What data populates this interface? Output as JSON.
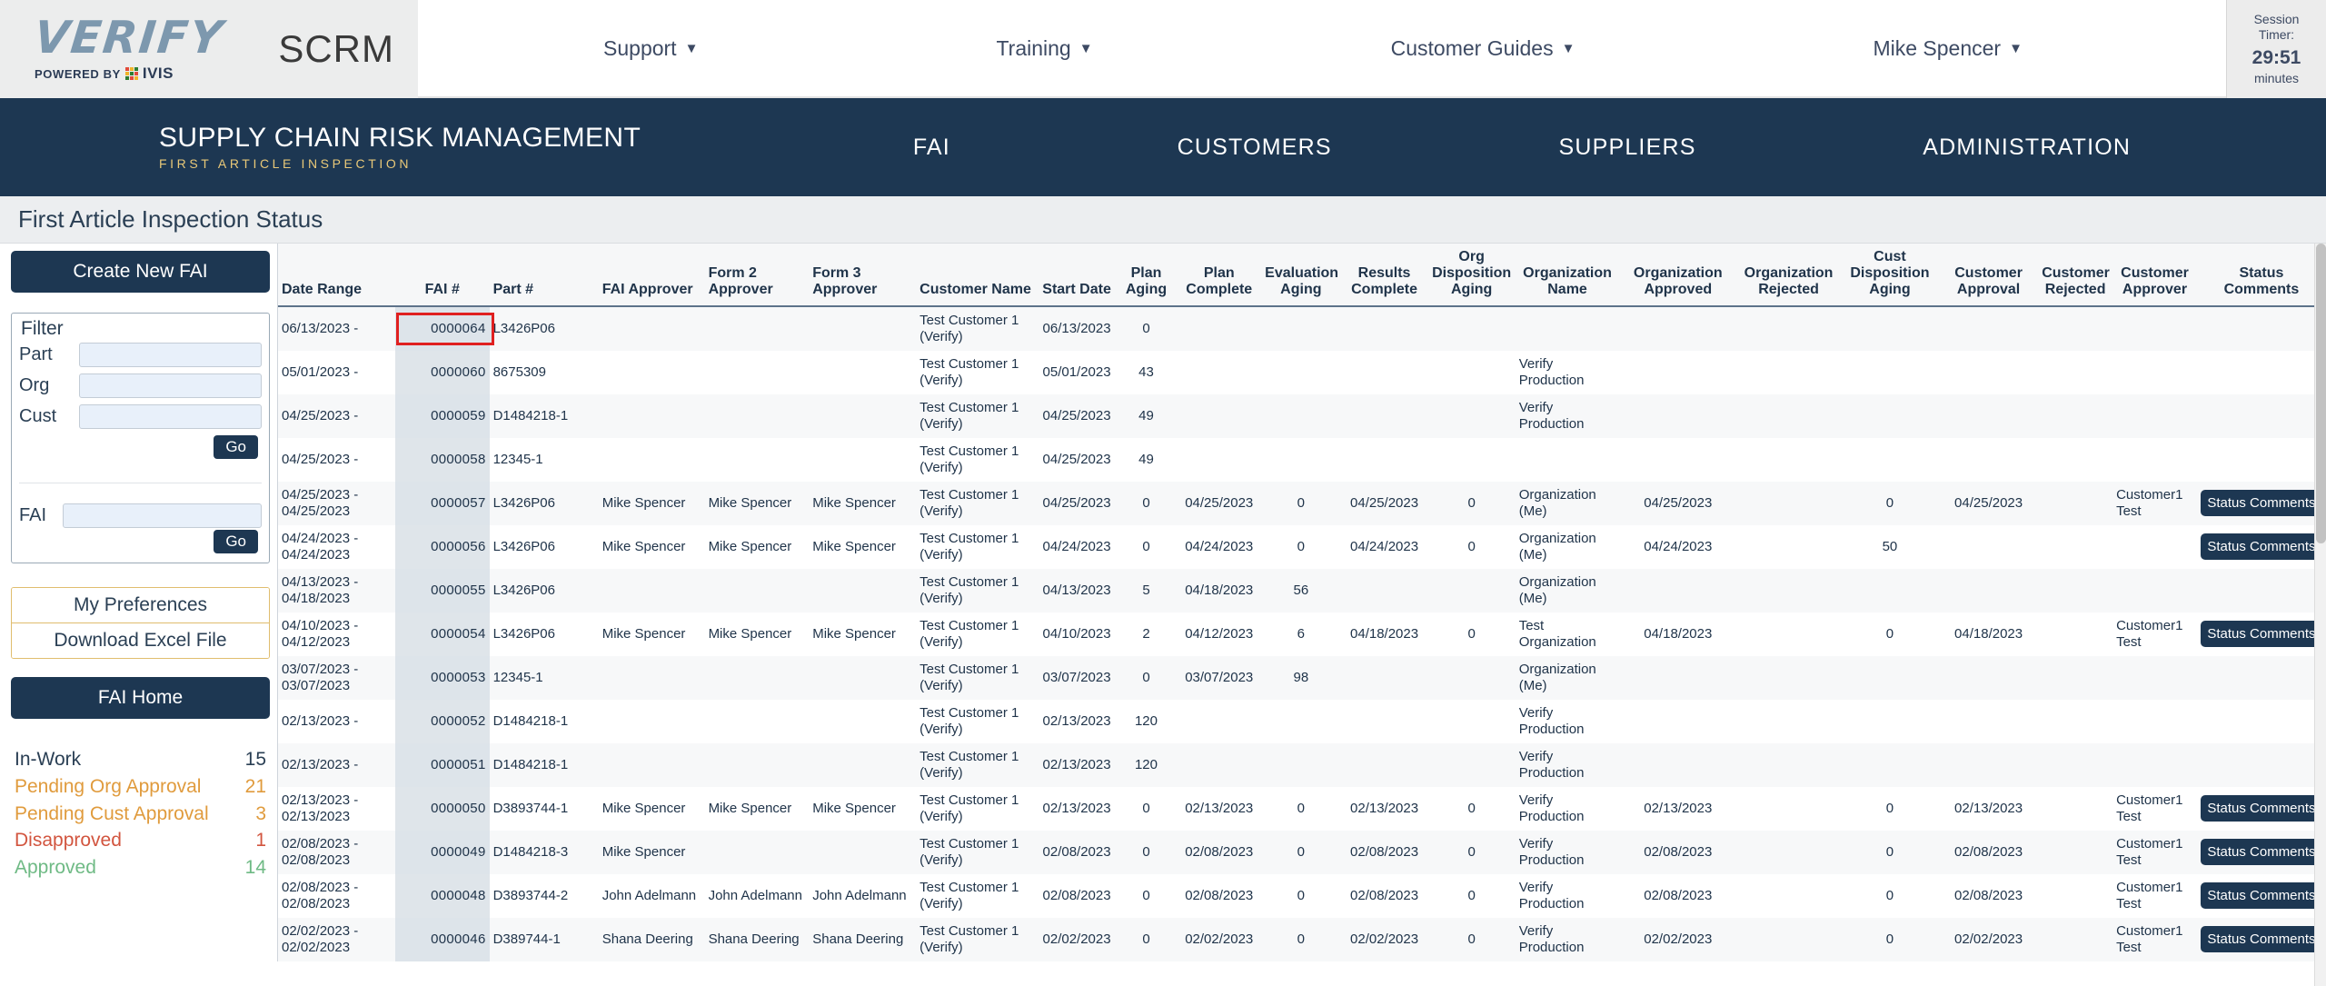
{
  "brand": {
    "logo_word": "VERIFY",
    "logo_powered_by": "POWERED BY",
    "logo_ivis": "IVIS",
    "app_abbrev": "SCRM"
  },
  "topnav": {
    "items": [
      {
        "label": "Support",
        "caret": "chevron-down-icon"
      },
      {
        "label": "Training",
        "caret": "chevron-down-icon"
      },
      {
        "label": "Customer Guides",
        "caret": "chevron-down-icon"
      },
      {
        "label": "Mike Spencer",
        "caret": "chevron-down-icon"
      }
    ],
    "session": {
      "line1": "Session",
      "line2": "Timer:",
      "time": "29:51",
      "unit": "minutes"
    }
  },
  "banner": {
    "title": "SUPPLY CHAIN RISK MANAGEMENT",
    "subtitle": "FIRST ARTICLE INSPECTION",
    "links": [
      "FAI",
      "CUSTOMERS",
      "SUPPLIERS",
      "ADMINISTRATION"
    ]
  },
  "page": {
    "title": "First Article Inspection Status"
  },
  "sidebar": {
    "create_button": "Create New FAI",
    "filter": {
      "title": "Filter",
      "part_label": "Part",
      "part_value": "",
      "org_label": "Org",
      "org_value": "",
      "cust_label": "Cust",
      "cust_value": "",
      "go_label": "Go",
      "fai_label": "FAI",
      "fai_value": "",
      "fai_go_label": "Go"
    },
    "preferences_label": "My Preferences",
    "download_label": "Download Excel File",
    "fai_home_label": "FAI Home",
    "stats": [
      {
        "label": "In-Work",
        "count": "15",
        "color": "#2a3f54"
      },
      {
        "label": "Pending Org Approval",
        "count": "21",
        "color": "#e09b3d"
      },
      {
        "label": "Pending Cust Approval",
        "count": "3",
        "color": "#e09b3d"
      },
      {
        "label": "Disapproved",
        "count": "1",
        "color": "#d2553f"
      },
      {
        "label": "Approved",
        "count": "14",
        "color": "#6fba85"
      }
    ]
  },
  "table": {
    "headers": [
      "Date Range",
      "FAI #",
      "Part #",
      "FAI Approver",
      "Form 2 Approver",
      "Form 3 Approver",
      "Customer Name",
      "Start Date",
      "Plan Aging",
      "Plan Complete",
      "Evaluation Aging",
      "Results Complete",
      "Org Disposition Aging",
      "Organization Name",
      "Organization Approved",
      "Organization Rejected",
      "Cust Disposition Aging",
      "Customer Approval",
      "Customer Rejected",
      "Customer Approver",
      "Status Comments"
    ],
    "status_button_label": "Status Comments",
    "highlighted_fai": "0000064",
    "rows": [
      {
        "date_range": "06/13/2023 -",
        "fai": "0000064",
        "part": "L3426P06",
        "fai_approver": "",
        "form2": "",
        "form3": "",
        "customer": "Test Customer 1 (Verify)",
        "start": "06/13/2023",
        "plan_aging": "0",
        "plan_complete": "",
        "eval_aging": "",
        "results_complete": "",
        "org_disp_aging": "",
        "org_name": "",
        "org_approved": "",
        "org_rejected": "",
        "cust_disp_aging": "",
        "cust_approval": "",
        "cust_rejected": "",
        "cust_approver": "",
        "status": false
      },
      {
        "date_range": "05/01/2023 -",
        "fai": "0000060",
        "part": "8675309",
        "fai_approver": "",
        "form2": "",
        "form3": "",
        "customer": "Test Customer 1 (Verify)",
        "start": "05/01/2023",
        "plan_aging": "43",
        "plan_complete": "",
        "eval_aging": "",
        "results_complete": "",
        "org_disp_aging": "",
        "org_name": "Verify Production",
        "org_approved": "",
        "org_rejected": "",
        "cust_disp_aging": "",
        "cust_approval": "",
        "cust_rejected": "",
        "cust_approver": "",
        "status": false
      },
      {
        "date_range": "04/25/2023 -",
        "fai": "0000059",
        "part": "D1484218-1",
        "fai_approver": "",
        "form2": "",
        "form3": "",
        "customer": "Test Customer 1 (Verify)",
        "start": "04/25/2023",
        "plan_aging": "49",
        "plan_complete": "",
        "eval_aging": "",
        "results_complete": "",
        "org_disp_aging": "",
        "org_name": "Verify Production",
        "org_approved": "",
        "org_rejected": "",
        "cust_disp_aging": "",
        "cust_approval": "",
        "cust_rejected": "",
        "cust_approver": "",
        "status": false
      },
      {
        "date_range": "04/25/2023 -",
        "fai": "0000058",
        "part": "12345-1",
        "fai_approver": "",
        "form2": "",
        "form3": "",
        "customer": "Test Customer 1 (Verify)",
        "start": "04/25/2023",
        "plan_aging": "49",
        "plan_complete": "",
        "eval_aging": "",
        "results_complete": "",
        "org_disp_aging": "",
        "org_name": "",
        "org_approved": "",
        "org_rejected": "",
        "cust_disp_aging": "",
        "cust_approval": "",
        "cust_rejected": "",
        "cust_approver": "",
        "status": false
      },
      {
        "date_range": "04/25/2023 - 04/25/2023",
        "fai": "0000057",
        "part": "L3426P06",
        "fai_approver": "Mike Spencer",
        "form2": "Mike Spencer",
        "form3": "Mike Spencer",
        "customer": "Test Customer 1 (Verify)",
        "start": "04/25/2023",
        "plan_aging": "0",
        "plan_complete": "04/25/2023",
        "eval_aging": "0",
        "results_complete": "04/25/2023",
        "org_disp_aging": "0",
        "org_name": "Organization (Me)",
        "org_approved": "04/25/2023",
        "org_rejected": "",
        "cust_disp_aging": "0",
        "cust_approval": "04/25/2023",
        "cust_rejected": "",
        "cust_approver": "Customer1 Test",
        "status": true
      },
      {
        "date_range": "04/24/2023 - 04/24/2023",
        "fai": "0000056",
        "part": "L3426P06",
        "fai_approver": "Mike Spencer",
        "form2": "Mike Spencer",
        "form3": "Mike Spencer",
        "customer": "Test Customer 1 (Verify)",
        "start": "04/24/2023",
        "plan_aging": "0",
        "plan_complete": "04/24/2023",
        "eval_aging": "0",
        "results_complete": "04/24/2023",
        "org_disp_aging": "0",
        "org_name": "Organization (Me)",
        "org_approved": "04/24/2023",
        "org_rejected": "",
        "cust_disp_aging": "50",
        "cust_approval": "",
        "cust_rejected": "",
        "cust_approver": "",
        "status": true
      },
      {
        "date_range": "04/13/2023 - 04/18/2023",
        "fai": "0000055",
        "part": "L3426P06",
        "fai_approver": "",
        "form2": "",
        "form3": "",
        "customer": "Test Customer 1 (Verify)",
        "start": "04/13/2023",
        "plan_aging": "5",
        "plan_complete": "04/18/2023",
        "eval_aging": "56",
        "results_complete": "",
        "org_disp_aging": "",
        "org_name": "Organization (Me)",
        "org_approved": "",
        "org_rejected": "",
        "cust_disp_aging": "",
        "cust_approval": "",
        "cust_rejected": "",
        "cust_approver": "",
        "status": false
      },
      {
        "date_range": "04/10/2023 - 04/12/2023",
        "fai": "0000054",
        "part": "L3426P06",
        "fai_approver": "Mike Spencer",
        "form2": "Mike Spencer",
        "form3": "Mike Spencer",
        "customer": "Test Customer 1 (Verify)",
        "start": "04/10/2023",
        "plan_aging": "2",
        "plan_complete": "04/12/2023",
        "eval_aging": "6",
        "results_complete": "04/18/2023",
        "org_disp_aging": "0",
        "org_name": "Test Organization",
        "org_approved": "04/18/2023",
        "org_rejected": "",
        "cust_disp_aging": "0",
        "cust_approval": "04/18/2023",
        "cust_rejected": "",
        "cust_approver": "Customer1 Test",
        "status": true
      },
      {
        "date_range": "03/07/2023 - 03/07/2023",
        "fai": "0000053",
        "part": "12345-1",
        "fai_approver": "",
        "form2": "",
        "form3": "",
        "customer": "Test Customer 1 (Verify)",
        "start": "03/07/2023",
        "plan_aging": "0",
        "plan_complete": "03/07/2023",
        "eval_aging": "98",
        "results_complete": "",
        "org_disp_aging": "",
        "org_name": "Organization (Me)",
        "org_approved": "",
        "org_rejected": "",
        "cust_disp_aging": "",
        "cust_approval": "",
        "cust_rejected": "",
        "cust_approver": "",
        "status": false
      },
      {
        "date_range": "02/13/2023 -",
        "fai": "0000052",
        "part": "D1484218-1",
        "fai_approver": "",
        "form2": "",
        "form3": "",
        "customer": "Test Customer 1 (Verify)",
        "start": "02/13/2023",
        "plan_aging": "120",
        "plan_complete": "",
        "eval_aging": "",
        "results_complete": "",
        "org_disp_aging": "",
        "org_name": "Verify Production",
        "org_approved": "",
        "org_rejected": "",
        "cust_disp_aging": "",
        "cust_approval": "",
        "cust_rejected": "",
        "cust_approver": "",
        "status": false
      },
      {
        "date_range": "02/13/2023 -",
        "fai": "0000051",
        "part": "D1484218-1",
        "fai_approver": "",
        "form2": "",
        "form3": "",
        "customer": "Test Customer 1 (Verify)",
        "start": "02/13/2023",
        "plan_aging": "120",
        "plan_complete": "",
        "eval_aging": "",
        "results_complete": "",
        "org_disp_aging": "",
        "org_name": "Verify Production",
        "org_approved": "",
        "org_rejected": "",
        "cust_disp_aging": "",
        "cust_approval": "",
        "cust_rejected": "",
        "cust_approver": "",
        "status": false
      },
      {
        "date_range": "02/13/2023 - 02/13/2023",
        "fai": "0000050",
        "part": "D3893744-1",
        "fai_approver": "Mike Spencer",
        "form2": "Mike Spencer",
        "form3": "Mike Spencer",
        "customer": "Test Customer 1 (Verify)",
        "start": "02/13/2023",
        "plan_aging": "0",
        "plan_complete": "02/13/2023",
        "eval_aging": "0",
        "results_complete": "02/13/2023",
        "org_disp_aging": "0",
        "org_name": "Verify Production",
        "org_approved": "02/13/2023",
        "org_rejected": "",
        "cust_disp_aging": "0",
        "cust_approval": "02/13/2023",
        "cust_rejected": "",
        "cust_approver": "Customer1 Test",
        "status": true
      },
      {
        "date_range": "02/08/2023 - 02/08/2023",
        "fai": "0000049",
        "part": "D1484218-3",
        "fai_approver": "Mike Spencer",
        "form2": "",
        "form3": "",
        "customer": "Test Customer 1 (Verify)",
        "start": "02/08/2023",
        "plan_aging": "0",
        "plan_complete": "02/08/2023",
        "eval_aging": "0",
        "results_complete": "02/08/2023",
        "org_disp_aging": "0",
        "org_name": "Verify Production",
        "org_approved": "02/08/2023",
        "org_rejected": "",
        "cust_disp_aging": "0",
        "cust_approval": "02/08/2023",
        "cust_rejected": "",
        "cust_approver": "Customer1 Test",
        "status": true
      },
      {
        "date_range": "02/08/2023 - 02/08/2023",
        "fai": "0000048",
        "part": "D3893744-2",
        "fai_approver": "John Adelmann",
        "form2": "John Adelmann",
        "form3": "John Adelmann",
        "customer": "Test Customer 1 (Verify)",
        "start": "02/08/2023",
        "plan_aging": "0",
        "plan_complete": "02/08/2023",
        "eval_aging": "0",
        "results_complete": "02/08/2023",
        "org_disp_aging": "0",
        "org_name": "Verify Production",
        "org_approved": "02/08/2023",
        "org_rejected": "",
        "cust_disp_aging": "0",
        "cust_approval": "02/08/2023",
        "cust_rejected": "",
        "cust_approver": "Customer1 Test",
        "status": true
      },
      {
        "date_range": "02/02/2023 - 02/02/2023",
        "fai": "0000046",
        "part": "D389744-1",
        "fai_approver": "Shana Deering",
        "form2": "Shana Deering",
        "form3": "Shana Deering",
        "customer": "Test Customer 1 (Verify)",
        "start": "02/02/2023",
        "plan_aging": "0",
        "plan_complete": "02/02/2023",
        "eval_aging": "0",
        "results_complete": "02/02/2023",
        "org_disp_aging": "0",
        "org_name": "Verify Production",
        "org_approved": "02/02/2023",
        "org_rejected": "",
        "cust_disp_aging": "0",
        "cust_approval": "02/02/2023",
        "cust_rejected": "",
        "cust_approver": "Customer1 Test",
        "status": true
      }
    ]
  }
}
